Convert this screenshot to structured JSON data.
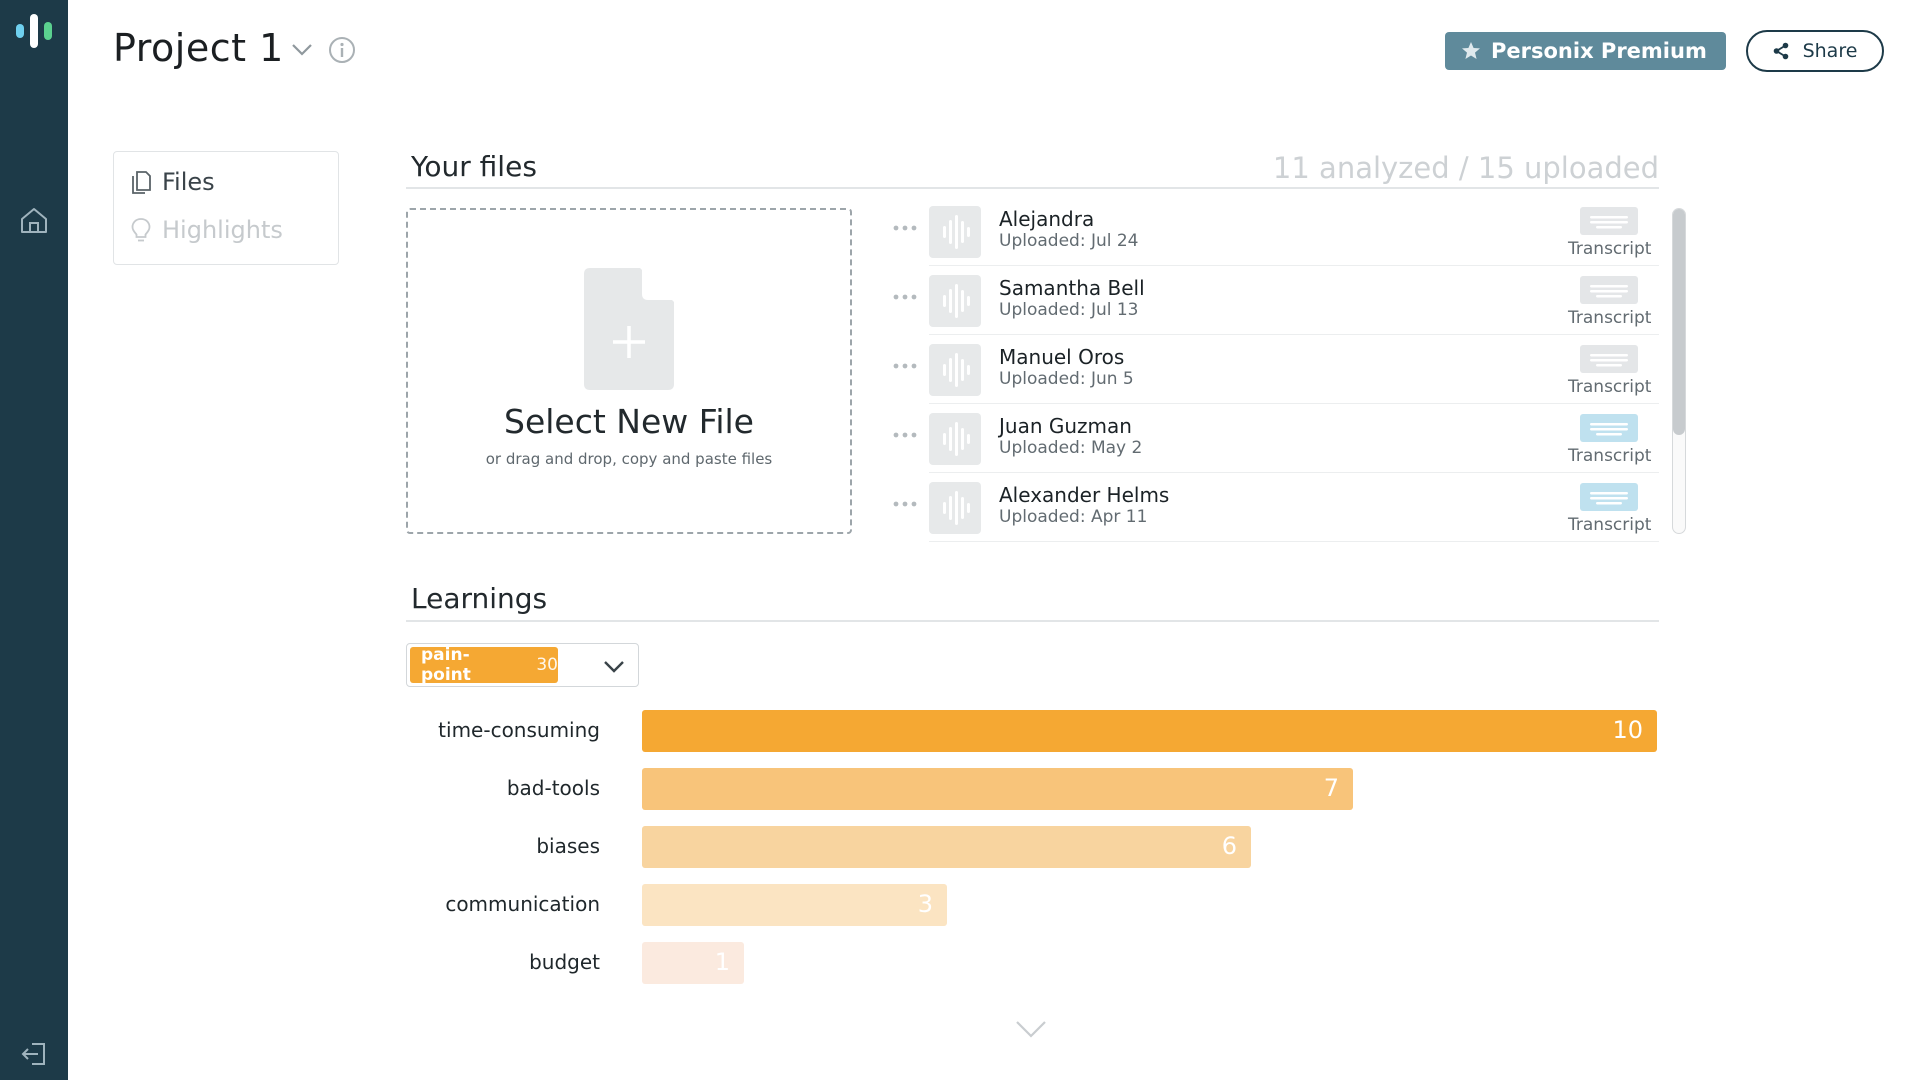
{
  "sidebar": {
    "logo_icon": "soundwave-logo-icon",
    "nav_home_icon": "home-icon",
    "nav_exit_icon": "logout-icon",
    "bg_color": "#1d3a48"
  },
  "header": {
    "project_title": "Project 1",
    "premium_label": "Personix Premium",
    "share_label": "Share"
  },
  "side_menu": {
    "items": [
      {
        "label": "Files",
        "icon": "file-icon",
        "active": true
      },
      {
        "label": "Highlights",
        "icon": "lightbulb-icon",
        "active": false
      }
    ]
  },
  "files_section": {
    "title": "Your files",
    "count_text": "11 analyzed / 15 uploaded",
    "upload": {
      "title": "Select New File",
      "subtitle": "or drag and drop, copy and paste files"
    },
    "files": [
      {
        "name": "Alejandra",
        "date": "Uploaded: Jul 24",
        "transcript_label": "Transcript",
        "transcript_status": "gray"
      },
      {
        "name": "Samantha Bell",
        "date": "Uploaded: Jul 13",
        "transcript_label": "Transcript",
        "transcript_status": "gray"
      },
      {
        "name": "Manuel Oros",
        "date": "Uploaded: Jun 5",
        "transcript_label": "Transcript",
        "transcript_status": "gray"
      },
      {
        "name": "Juan Guzman",
        "date": "Uploaded: May 2",
        "transcript_label": "Transcript",
        "transcript_status": "blue"
      },
      {
        "name": "Alexander Helms",
        "date": "Uploaded: Apr 11",
        "transcript_label": "Transcript",
        "transcript_status": "blue"
      }
    ]
  },
  "learnings": {
    "title": "Learnings",
    "selected_tag": {
      "label": "pain-point",
      "count": "30",
      "color": "#f5a833"
    },
    "chart_data": {
      "type": "bar",
      "orientation": "horizontal",
      "categories": [
        "time-consuming",
        "bad-tools",
        "biases",
        "communication",
        "budget"
      ],
      "values": [
        10,
        7,
        6,
        3,
        1
      ],
      "colors": [
        "#f5a833",
        "#f8c47a",
        "#f8d49f",
        "#fbe4c2",
        "#fbeadf"
      ]
    }
  }
}
